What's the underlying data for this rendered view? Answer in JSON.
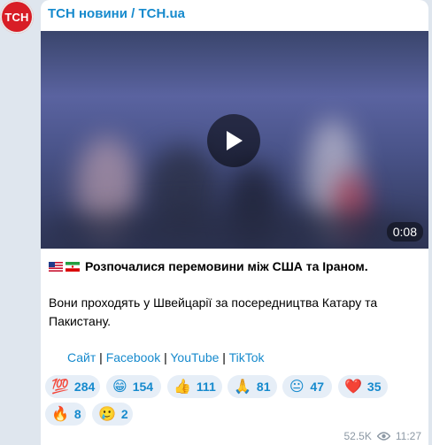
{
  "channel": {
    "name": "ТСН новини / TCH.ua",
    "avatar_text": "TCH"
  },
  "video": {
    "duration": "0:08"
  },
  "post": {
    "title": "Розпочалися перемовини між США та Іраном.",
    "body": "Вони проходять у Швейцарії за посередництва Катару та Пакистану.",
    "links": [
      "Сайт",
      "Facebook",
      "YouTube",
      "TikTok"
    ]
  },
  "reactions": [
    {
      "emoji": "💯",
      "count": "284"
    },
    {
      "emoji": "😁",
      "count": "154"
    },
    {
      "emoji": "👍",
      "count": "111"
    },
    {
      "emoji": "🙏",
      "count": "81"
    },
    {
      "emoji": "😐",
      "count": "47"
    },
    {
      "emoji": "❤️",
      "count": "35"
    },
    {
      "emoji": "🔥",
      "count": "8"
    },
    {
      "emoji": "🥲",
      "count": "2"
    }
  ],
  "meta": {
    "views": "52.5K",
    "time": "11:27"
  },
  "colors": {
    "accent": "#168acd",
    "avatar_bg": "#d81d26",
    "bubble_bg": "#ffffff",
    "page_bg": "#dfe6ee"
  }
}
